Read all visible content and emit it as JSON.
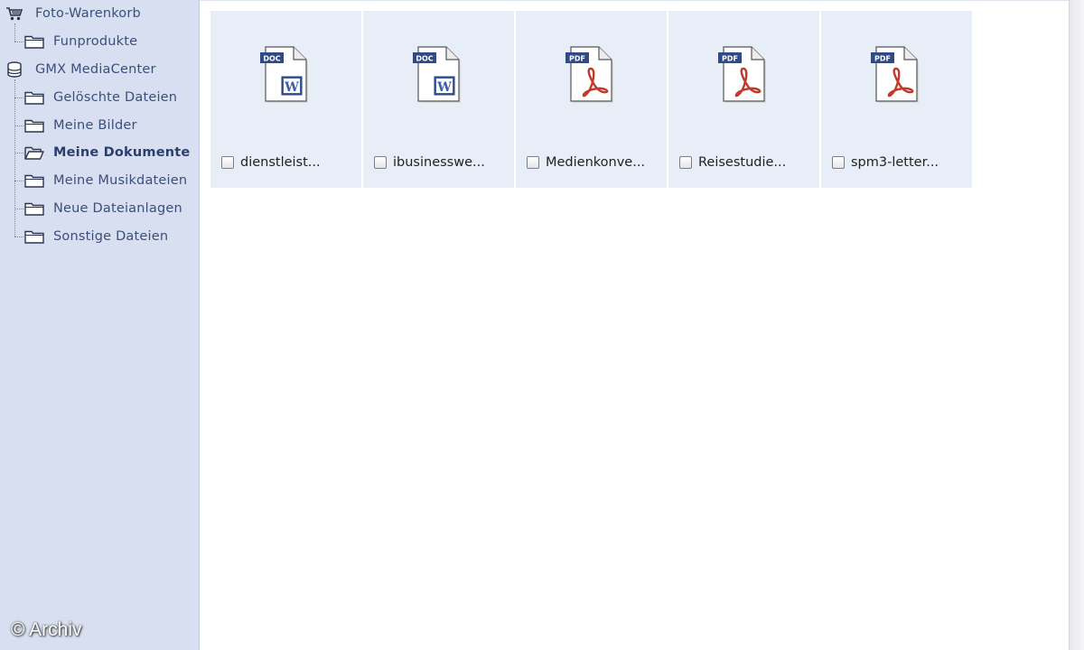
{
  "sidebar": {
    "items": [
      {
        "label": "Foto-Warenkorb",
        "icon": "cart-icon",
        "level": 0
      },
      {
        "label": "Funprodukte",
        "icon": "folder-icon",
        "level": 1
      },
      {
        "label": "GMX MediaCenter",
        "icon": "database-icon",
        "level": 0
      },
      {
        "label": "Gelöschte Dateien",
        "icon": "folder-icon",
        "level": 1
      },
      {
        "label": "Meine Bilder",
        "icon": "folder-icon",
        "level": 1
      },
      {
        "label": "Meine Dokumente",
        "icon": "folder-open-icon",
        "level": 1,
        "active": true
      },
      {
        "label": "Meine Musikdateien",
        "icon": "folder-icon",
        "level": 1
      },
      {
        "label": "Neue Dateianlagen",
        "icon": "folder-icon",
        "level": 1
      },
      {
        "label": "Sonstige Dateien",
        "icon": "folder-icon",
        "level": 1
      }
    ]
  },
  "files": [
    {
      "name": "dienstleist...",
      "type_label": "DOC",
      "icon": "word-document-icon"
    },
    {
      "name": "ibusinesswe...",
      "type_label": "DOC",
      "icon": "word-document-icon"
    },
    {
      "name": "Medienkonve...",
      "type_label": "PDF",
      "icon": "pdf-document-icon"
    },
    {
      "name": "Reisestudie...",
      "type_label": "PDF",
      "icon": "pdf-document-icon"
    },
    {
      "name": "spm3-letter...",
      "type_label": "PDF",
      "icon": "pdf-document-icon"
    }
  ],
  "watermark": "© Archiv",
  "colors": {
    "sidebar_bg": "#d7dff0",
    "tile_bg": "#e8eef7",
    "tree_text": "#3c4f7c",
    "doc_blue": "#3a5ea8",
    "pdf_red": "#c0392b"
  }
}
